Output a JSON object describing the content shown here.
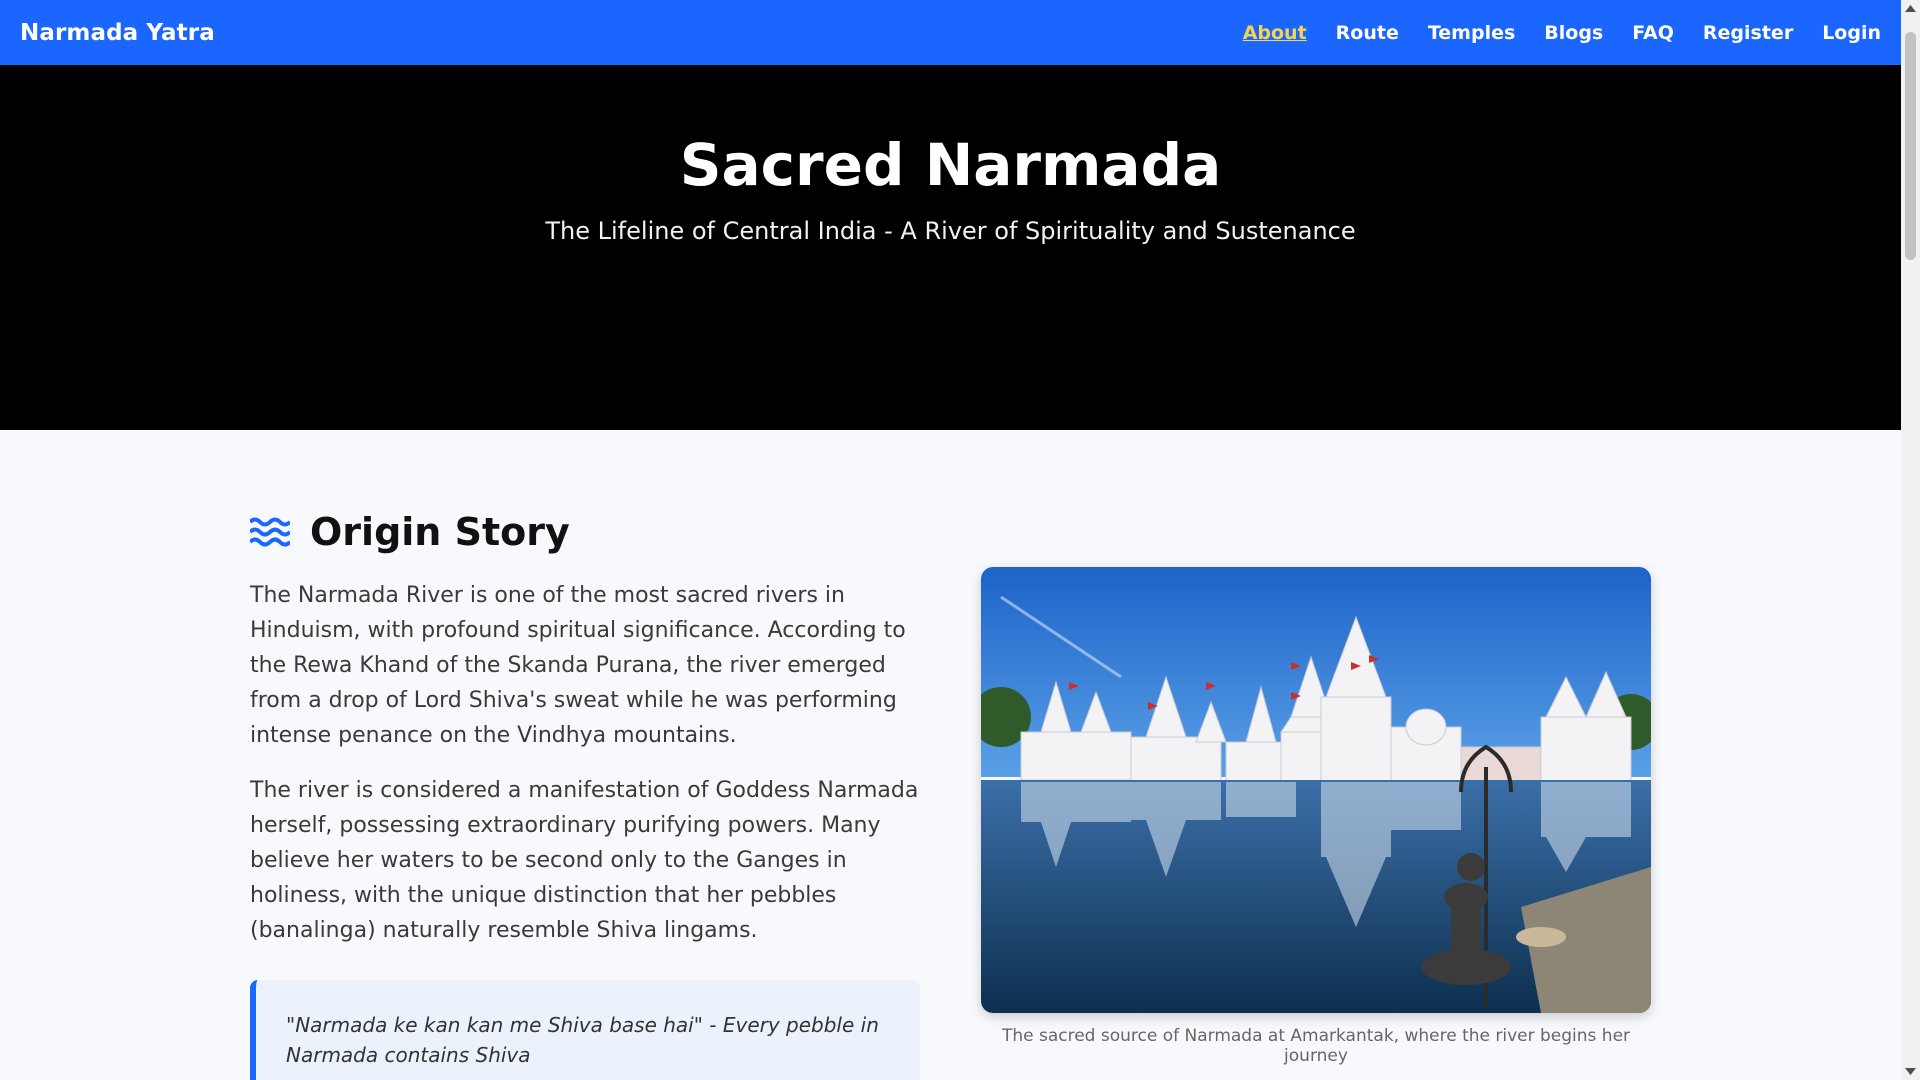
{
  "nav": {
    "brand": "Narmada Yatra",
    "links": [
      "About",
      "Route",
      "Temples",
      "Blogs",
      "FAQ",
      "Register",
      "Login"
    ],
    "active": "About"
  },
  "hero": {
    "title": "Sacred Narmada",
    "subtitle": "The Lifeline of Central India - A River of Spirituality and Sustenance"
  },
  "origin": {
    "heading": "Origin Story",
    "icon": "water-waves-icon",
    "para1": "The Narmada River is one of the most sacred rivers in Hinduism, with profound spiritual significance. According to the Rewa Khand of the Skanda Purana, the river emerged from a drop of Lord Shiva's sweat while he was performing intense penance on the Vindhya mountains.",
    "para2": "The river is considered a manifestation of Goddess Narmada herself, possessing extraordinary purifying powers. Many believe her waters to be second only to the Ganges in holiness, with the unique distinction that her pebbles (banalinga) naturally resemble Shiva lingams.",
    "quote": "\"Narmada ke kan kan me Shiva base hai\" - Every pebble in Narmada contains Shiva",
    "caption": "The sacred source of Narmada at Amarkantak, where the river begins her journey"
  },
  "colors": {
    "nav_bg": "#1a66ff",
    "active_link": "#f7d54a",
    "hero_bg": "#000000",
    "accent": "#1a66ff"
  }
}
